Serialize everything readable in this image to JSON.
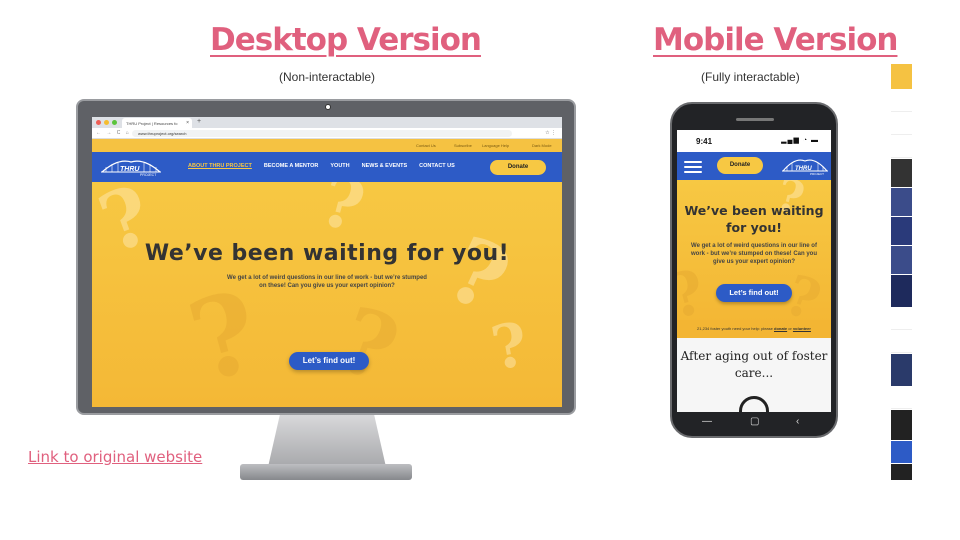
{
  "headings": {
    "desktop": "Desktop Version",
    "desktop_sub": "(Non-interactable)",
    "mobile": "Mobile Version",
    "mobile_sub": "(Fully interactable)"
  },
  "link_original": "Link to original website",
  "browser": {
    "tab_title": "THRU Project | Resources fo",
    "tab_close": "×",
    "new_tab": "+",
    "nav_buttons": "← → C ⌂",
    "url": "www.thruproject.org/search",
    "icons": "☆ ⋮"
  },
  "site": {
    "utility_links": [
      "Contact Us",
      "Subscribe",
      "Language Help",
      "Dark Mode"
    ],
    "nav_links": [
      "ABOUT THRU PROJECT",
      "BECOME A MENTOR",
      "YOUTH",
      "NEWS & EVENTS",
      "CONTACT US"
    ],
    "donate": "Donate",
    "hero_title": "We’ve been waiting for you!",
    "hero_text": "We get a lot of weird questions in our line of work - but we’re stumped on these! Can you give us your expert opinion?",
    "cta": "Let’s find out!"
  },
  "mobile": {
    "time": "9:41",
    "status_icons": "▂▄▆ ◔ ▬",
    "donate": "Donate",
    "hero_title": "We’ve been waiting for you!",
    "hero_text": "We get a lot of weird questions in our line of work - but we’re stumped on these! Can you give us your expert opinion?",
    "cta": "Let’s find out!",
    "foster_prefix": "21,234 foster youth need your help: please",
    "foster_donate": "donate",
    "foster_or": "or",
    "foster_volunteer": "volunteer",
    "section_title": "After aging out of foster care...",
    "android_buttons": [
      "—",
      "▢",
      "‹"
    ]
  },
  "thumbnail_colors": [
    "#f5c242",
    "#ffffff",
    "#ffffff",
    "#ffffff",
    "#333333",
    "#3b4c8a",
    "#2a3a7a",
    "#3b4c8a",
    "#1e2a5c",
    "#ffffff",
    "#ffffff",
    "#2a3a6a",
    "#ffffff",
    "#222222",
    "#2d5bc6",
    "#222222"
  ],
  "colors": {
    "accent": "#e0607e",
    "brand_blue": "#2d5bc6",
    "brand_yellow": "#f7c843"
  }
}
